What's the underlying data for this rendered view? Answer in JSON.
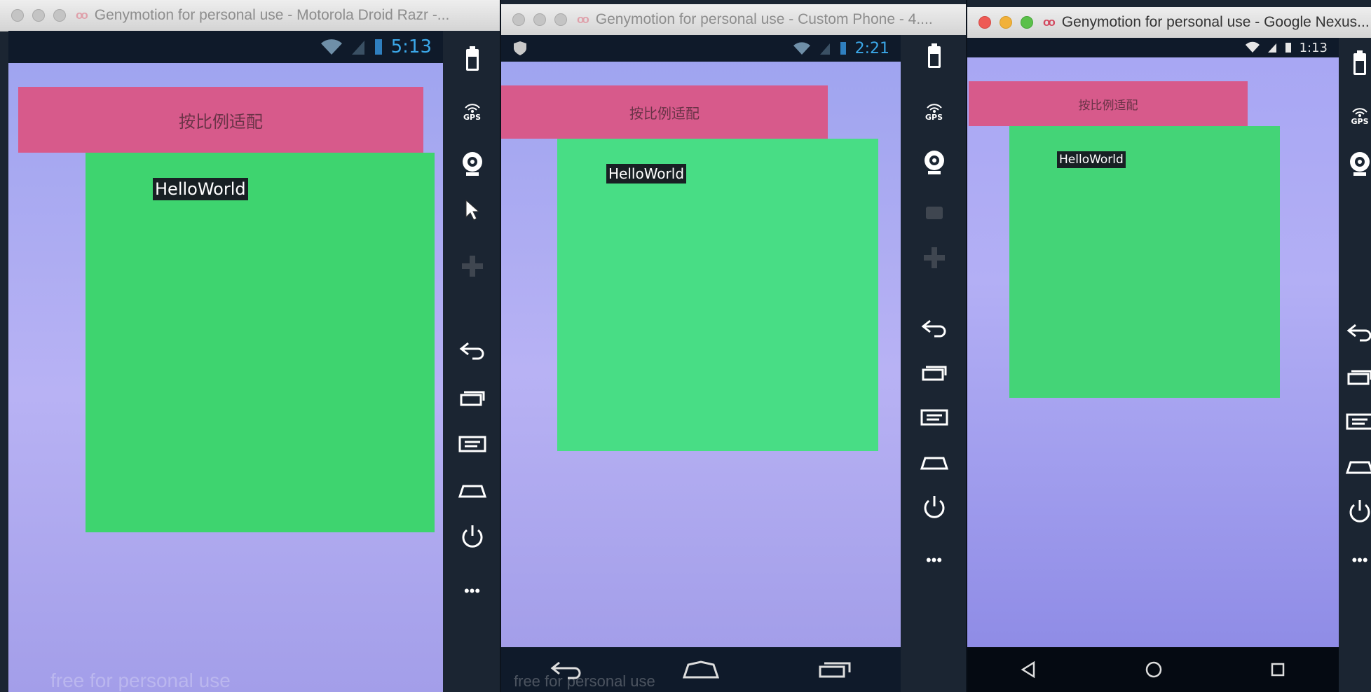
{
  "windows": [
    {
      "title": "Genymotion for personal use - Motorola Droid Razr -...",
      "status_time": "5:13",
      "header_text": "按比例适配",
      "label_text": "HelloWorld",
      "watermark": "free for personal use"
    },
    {
      "title": "Genymotion for personal use - Custom Phone - 4....",
      "status_time": "2:21",
      "header_text": "按比例适配",
      "label_text": "HelloWorld",
      "watermark": "free for personal use"
    },
    {
      "title": "Genymotion for personal use - Google Nexus...",
      "status_time": "1:13",
      "header_text": "按比例适配",
      "label_text": "HelloWorld"
    }
  ],
  "sidebar": {
    "gps_label": "GPS",
    "more_label": "•••"
  },
  "colors": {
    "header_pink": "#d75a8b",
    "content_green": "#3ed46f",
    "screen_lavender": "#a9a8f0",
    "status_blue": "#3ba7e8"
  }
}
